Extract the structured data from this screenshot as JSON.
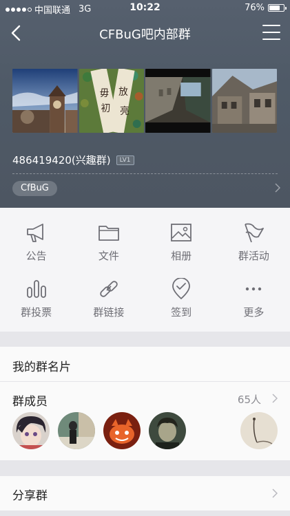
{
  "status_bar": {
    "carrier": "中国联通",
    "network": "3G",
    "time": "10:22",
    "battery_percent": "76%",
    "battery_level": 0.76
  },
  "nav": {
    "title": "CFBuG吧内部群",
    "back_icon": "chevron-left-icon",
    "menu_icon": "hamburger-menu-icon"
  },
  "group": {
    "id_text": "486419420(兴趣群)",
    "level_badge": "LV1",
    "tag": "CfBuG"
  },
  "features": [
    {
      "label": "公告",
      "icon": "megaphone-icon"
    },
    {
      "label": "文件",
      "icon": "folder-icon"
    },
    {
      "label": "相册",
      "icon": "photo-album-icon"
    },
    {
      "label": "群活动",
      "icon": "flag-icon"
    },
    {
      "label": "群投票",
      "icon": "bar-chart-icon"
    },
    {
      "label": "群链接",
      "icon": "link-icon"
    },
    {
      "label": "签到",
      "icon": "check-in-location-icon"
    },
    {
      "label": "更多",
      "icon": "more-dots-icon"
    }
  ],
  "name_card": {
    "label": "我的群名片"
  },
  "members": {
    "label": "群成员",
    "count": "65人"
  },
  "share": {
    "label": "分享群"
  },
  "colors": {
    "header_bg": "#4f5a67",
    "page_bg": "#efeff2",
    "grid_label": "#6e6e75",
    "icon_stroke": "#6e6e75"
  }
}
